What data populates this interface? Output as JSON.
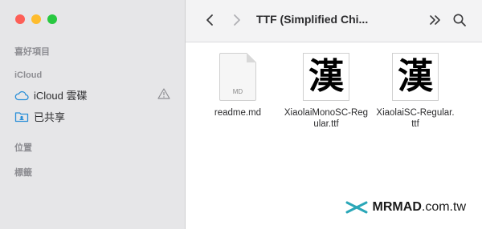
{
  "sidebar": {
    "section_favorites": "喜好項目",
    "section_icloud": "iCloud",
    "items": [
      {
        "label": "iCloud 雲碟",
        "icon": "cloud-icon"
      },
      {
        "label": "已共享",
        "icon": "shared-folder-icon"
      }
    ],
    "section_locations": "位置",
    "section_tags": "標籤"
  },
  "toolbar": {
    "title": "TTF (Simplified Chi..."
  },
  "files": [
    {
      "name": "readme.md",
      "type": "document",
      "ext": "MD"
    },
    {
      "name": "XiaolaiMonoSC-Regular.ttf",
      "type": "font",
      "glyph": "漢"
    },
    {
      "name": "XiaolaiSC-Regular.ttf",
      "type": "font",
      "glyph": "漢"
    }
  ],
  "watermark": {
    "brand": "MRMAD",
    "suffix": ".com.tw"
  },
  "colors": {
    "accent": "#2aa7b8",
    "close": "#fd5f57",
    "minimize": "#febc2e",
    "zoom": "#28c840"
  }
}
